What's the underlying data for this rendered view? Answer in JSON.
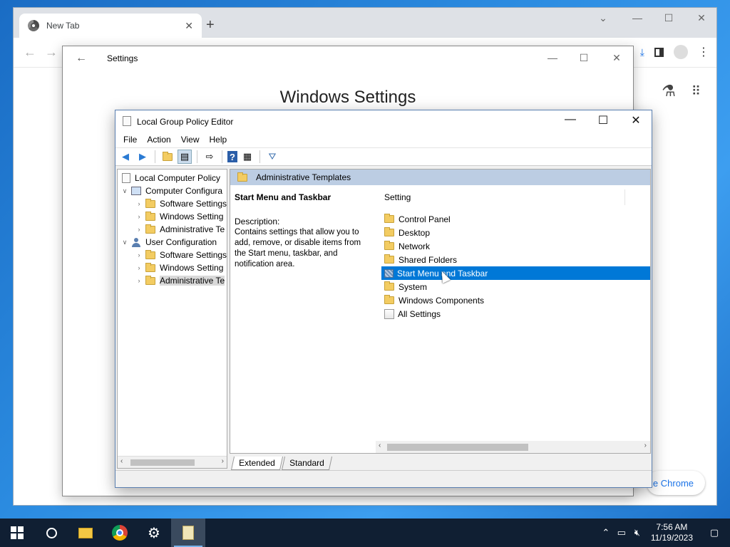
{
  "chrome": {
    "tab_title": "New Tab",
    "new_tab_symbol": "+",
    "customize_label": "ize Chrome",
    "back": "←",
    "forward": "→"
  },
  "settings": {
    "title": "Settings",
    "heading": "Windows Settings",
    "back": "←"
  },
  "gpedit": {
    "title": "Local Group Policy Editor",
    "menu": [
      "File",
      "Action",
      "View",
      "Help"
    ],
    "tree": [
      {
        "label": "Local Computer Policy",
        "level": 0,
        "icon": "doc"
      },
      {
        "label": "Computer Configura",
        "level": 1,
        "icon": "pc",
        "toggle": "v"
      },
      {
        "label": "Software Settings",
        "level": 2,
        "icon": "folder",
        "toggle": ">"
      },
      {
        "label": "Windows Setting",
        "level": 2,
        "icon": "folder",
        "toggle": ">"
      },
      {
        "label": "Administrative Te",
        "level": 2,
        "icon": "folder",
        "toggle": ">"
      },
      {
        "label": "User Configuration",
        "level": 1,
        "icon": "user",
        "toggle": "v"
      },
      {
        "label": "Software Settings",
        "level": 2,
        "icon": "folder",
        "toggle": ">"
      },
      {
        "label": "Windows Setting",
        "level": 2,
        "icon": "folder",
        "toggle": ">"
      },
      {
        "label": "Administrative Te",
        "level": 2,
        "icon": "folder",
        "toggle": ">",
        "selected": true
      }
    ],
    "right_header": "Administrative Templates",
    "description": {
      "title": "Start Menu and Taskbar",
      "label": "Description:",
      "text": "Contains settings that allow you to add, remove, or disable items from the Start menu, taskbar, and notification area."
    },
    "list_header": "Setting",
    "list": [
      {
        "label": "Control Panel",
        "icon": "folder"
      },
      {
        "label": "Desktop",
        "icon": "folder"
      },
      {
        "label": "Network",
        "icon": "folder"
      },
      {
        "label": "Shared Folders",
        "icon": "folder"
      },
      {
        "label": "Start Menu and Taskbar",
        "icon": "policy",
        "selected": true
      },
      {
        "label": "System",
        "icon": "folder"
      },
      {
        "label": "Windows Components",
        "icon": "folder"
      },
      {
        "label": "All Settings",
        "icon": "allsettings"
      }
    ],
    "tabs": [
      "Extended",
      "Standard"
    ]
  },
  "taskbar": {
    "time": "7:56 AM",
    "date": "11/19/2023"
  }
}
